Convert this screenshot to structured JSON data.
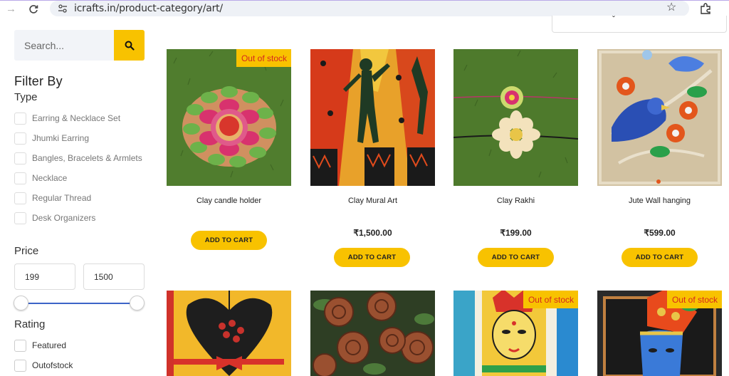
{
  "browser": {
    "url": "icrafts.in/product-category/art/"
  },
  "search": {
    "placeholder": "Search..."
  },
  "filters": {
    "title": "Filter By",
    "type_title": "Type",
    "types": [
      "Earring & Necklace Set",
      "Jhumki Earring",
      "Bangles, Bracelets & Armlets",
      "Necklace",
      "Regular Thread",
      "Desk Organizers"
    ],
    "price_title": "Price",
    "price_min": "199",
    "price_max": "1500",
    "rating_title": "Rating",
    "rating_options": [
      "Featured",
      "Outofstock"
    ]
  },
  "products": [
    {
      "name": "Clay candle holder",
      "price": "",
      "badge": "Out of stock",
      "button": "ADD TO CART"
    },
    {
      "name": "Clay Mural Art",
      "price": "₹1,500.00",
      "badge": "",
      "button": "ADD TO CART"
    },
    {
      "name": "Clay Rakhi",
      "price": "₹199.00",
      "badge": "",
      "button": "ADD TO CART"
    },
    {
      "name": "Jute Wall hanging",
      "price": "₹599.00",
      "badge": "",
      "button": "ADD TO CART"
    }
  ],
  "products_row2": [
    {
      "badge": ""
    },
    {
      "badge": ""
    },
    {
      "badge": "Out of stock"
    },
    {
      "badge": "Out of stock"
    }
  ],
  "colors": {
    "accent": "#f8c200",
    "oos_text": "#d6271e",
    "slider": "#3c64c8"
  }
}
